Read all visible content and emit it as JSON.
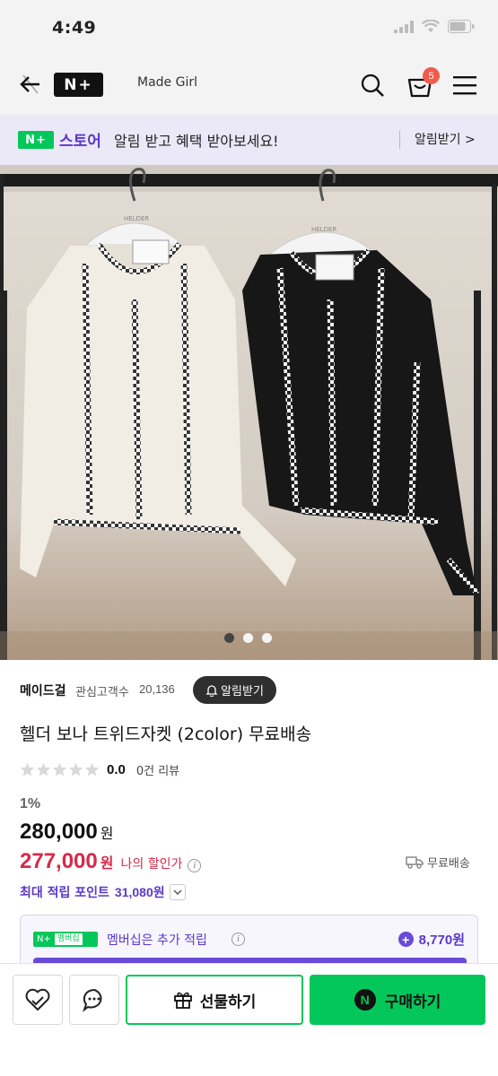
{
  "status_bar": {
    "time": "4:49"
  },
  "header": {
    "logo_text": "N+",
    "store_name": "Made Girl",
    "cart_count": "5"
  },
  "notice": {
    "logo_text": "N+",
    "store_label": "스토어",
    "message": "알림 받고 혜택 받아보세요!",
    "cta": "알림받기 >"
  },
  "image": {
    "hanger_brand": "HELDER",
    "carousel_total": 3,
    "carousel_active": 1
  },
  "seller": {
    "name": "메이드걸",
    "followers_label": "관심고객수",
    "followers_count": "20,136",
    "alarm_button": "알림받기"
  },
  "product": {
    "title": "헬더 보나 트위드자켓 (2color) 무료배송",
    "rating": "0.0",
    "reviews": "0건 리뷰",
    "rating_stars": 0,
    "discount_rate": "1%",
    "original_price": "280,000",
    "sale_price": "277,000",
    "currency": "원",
    "my_discount_label": "나의 할인가",
    "shipping": "무료배송",
    "points_label": "최대 적립 포인트",
    "points_value": "31,080원"
  },
  "membership": {
    "logo_text": "N+",
    "badge": "멤버십",
    "text": "멤버십은 추가 적립",
    "points": "8,770원"
  },
  "bottom_bar": {
    "gift_label": "선물하기",
    "buy_label": "구매하기",
    "npay_text": "N"
  },
  "colors": {
    "naver_green": "#03c75a",
    "accent_purple": "#5a38c9",
    "sale_red": "#d62a4a",
    "badge_red": "#f25b4b"
  }
}
